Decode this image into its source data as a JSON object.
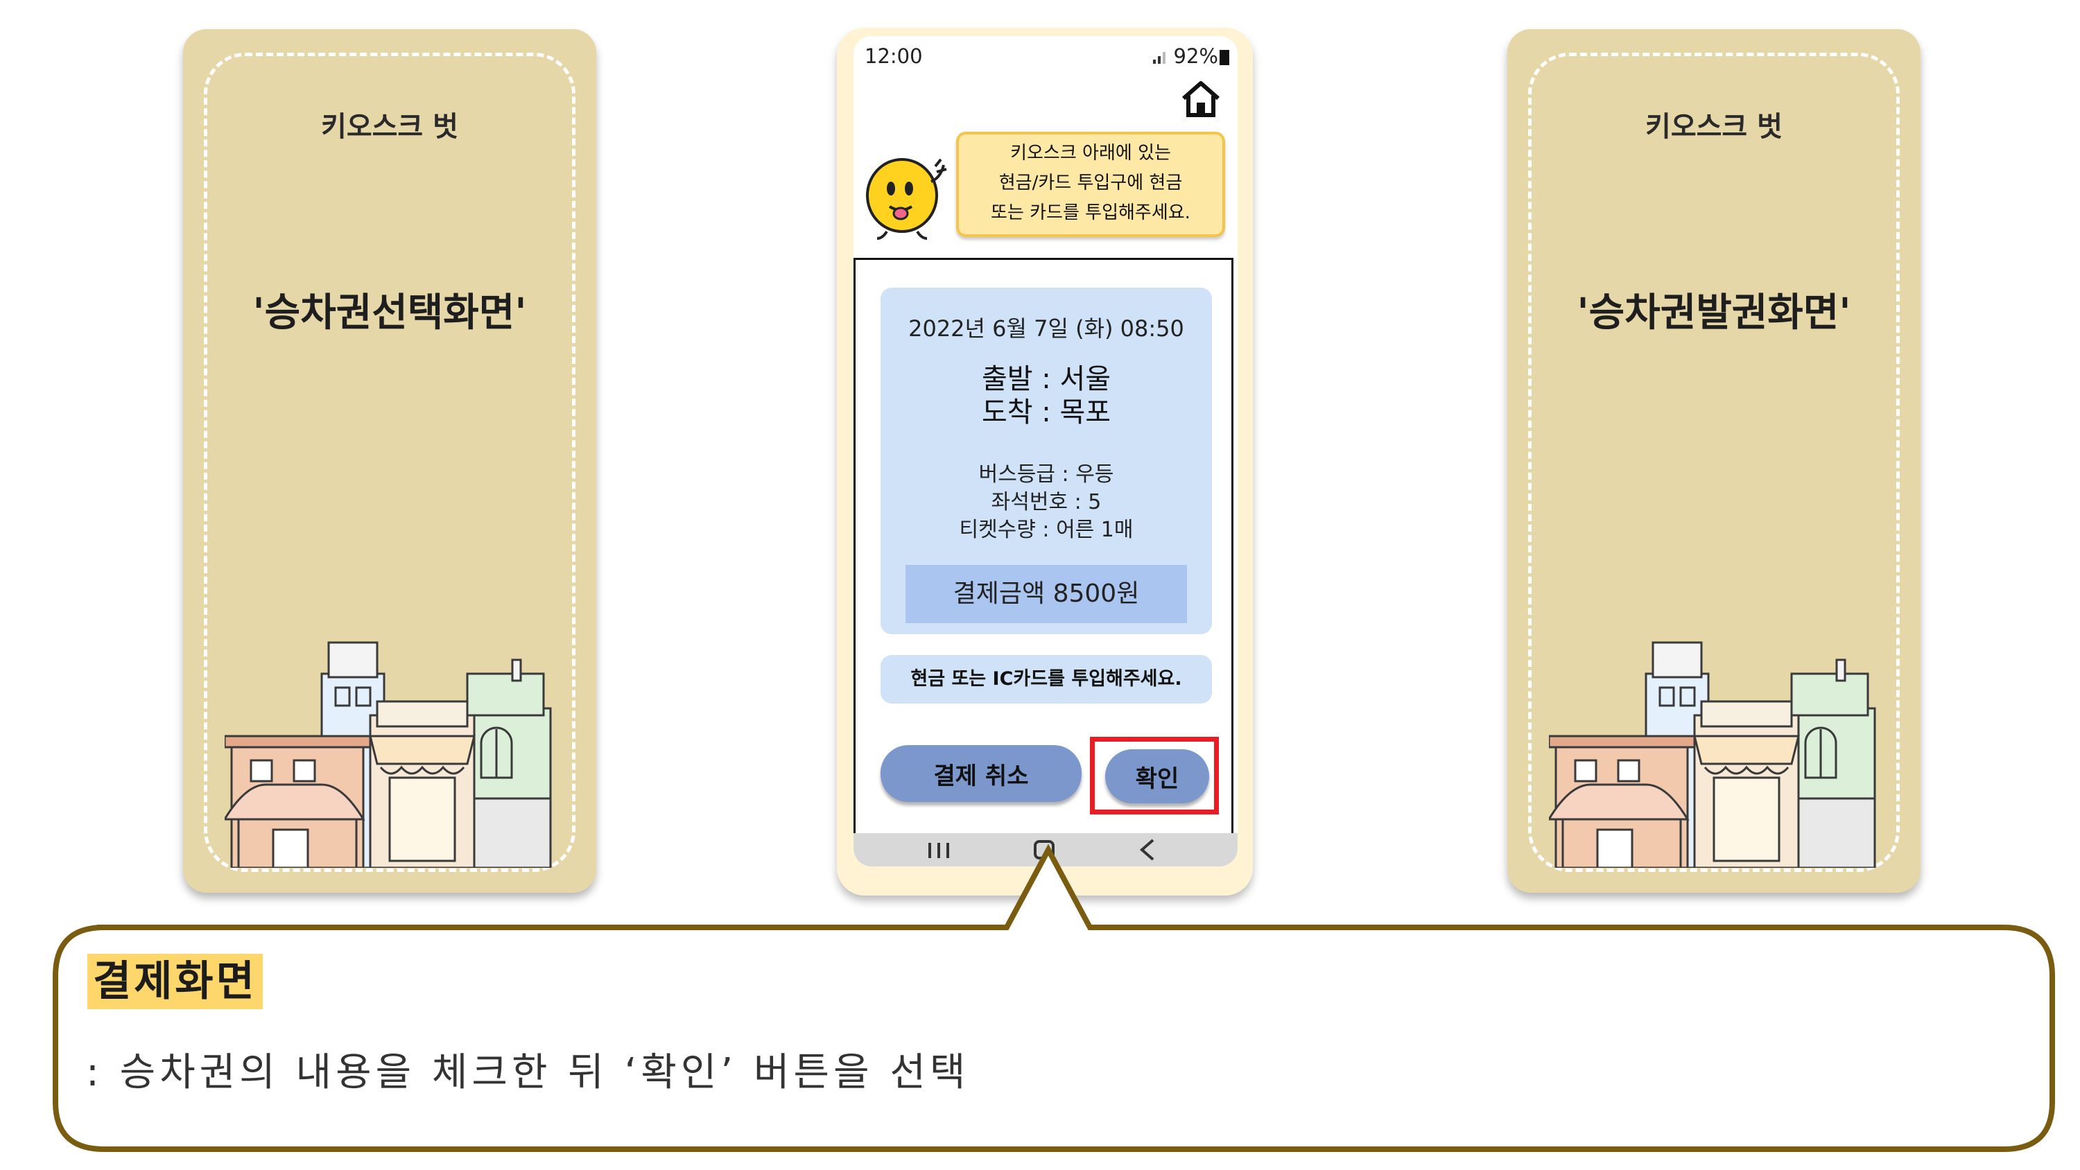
{
  "left_card": {
    "title": "키오스크 벗",
    "screen_name": "'승차권선택화면'"
  },
  "right_card": {
    "title": "키오스크 벗",
    "screen_name": "'승차권발권화면'"
  },
  "phone": {
    "status": {
      "time": "12:00",
      "battery": "92%"
    },
    "bubble_lines": [
      "키오스크 아래에 있는",
      "현금/카드 투입구에 현금",
      "또는 카드를 투입해주세요."
    ],
    "ticket": {
      "datetime": "2022년 6월 7일 (화) 08:50",
      "departure": "출발 : 서울",
      "arrival": "도착 : 목포",
      "bus_grade": "버스등급 : 우등",
      "seat": "좌석번호 : 5",
      "quantity": "티켓수량 : 어른 1매",
      "payment": "결제금액 8500원"
    },
    "insert_message": "현금 또는 IC카드를 투입해주세요.",
    "buttons": {
      "cancel": "결제 취소",
      "confirm": "확인"
    }
  },
  "callout": {
    "title": "결제화면",
    "description": ": 승차권의 내용을 체크한 뒤 ‘확인’ 버튼을 선택"
  },
  "colors": {
    "card_bg": "#e6d7a8",
    "phone_frame": "#fff3d3",
    "ticket_bg": "#cfe2f8",
    "button_bg": "#7b97cc",
    "highlight_red": "#ea1c24",
    "callout_border": "#7a5c10",
    "title_highlight": "#fdd76b"
  }
}
